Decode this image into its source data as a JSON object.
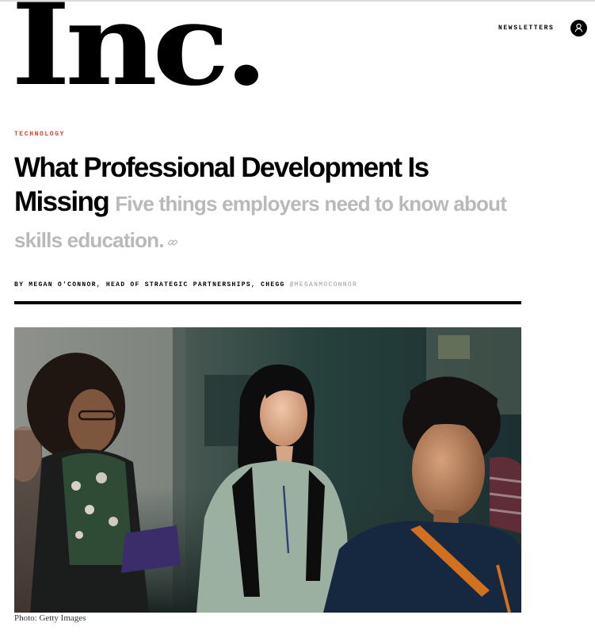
{
  "header": {
    "logo_text": "Inc.",
    "newsletters_label": "NEWSLETTERS",
    "account_icon": "user-icon"
  },
  "article": {
    "category": "TECHNOLOGY",
    "title": "What Professional Development Is Missing",
    "dek": "Five things employers need to know about skills education.",
    "link_icon": "link-icon",
    "byline": "BY MEGAN O'CONNOR, HEAD OF STRATEGIC PARTNERSHIPS, CHEGG",
    "author_handle": "@MEGANMOCONNOR",
    "photo_caption": "Photo: Getty Images"
  },
  "colors": {
    "accent": "#e0422a",
    "dek": "#b9b9b9",
    "handle": "#9a9a9a"
  }
}
